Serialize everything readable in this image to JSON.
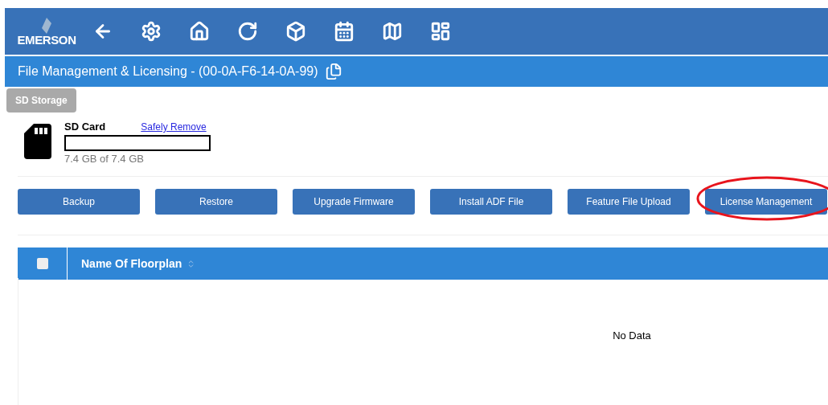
{
  "header": {
    "logo": "EMERSON",
    "toolbar": [
      {
        "kind": "back"
      },
      {
        "kind": "settings"
      },
      {
        "kind": "home"
      },
      {
        "kind": "refresh"
      },
      {
        "kind": "box"
      },
      {
        "kind": "calendar"
      },
      {
        "kind": "map"
      },
      {
        "kind": "dashboard"
      }
    ]
  },
  "title_bar": {
    "title": "File Management & Licensing - (00-0A-F6-14-0A-99)"
  },
  "storage": {
    "tooltip": "SD Storage",
    "name": "SD Card",
    "link": "Safely Remove",
    "level": 0,
    "usage": "7.4 GB of 7.4 GB"
  },
  "buttons": [
    {
      "label": "Backup",
      "highlighted": false
    },
    {
      "label": "Restore",
      "highlighted": false
    },
    {
      "label": "Upgrade Firmware",
      "highlighted": false
    },
    {
      "label": "Install ADF File",
      "highlighted": false
    },
    {
      "label": "Feature File Upload",
      "highlighted": false
    },
    {
      "label": "License Management",
      "highlighted": true
    }
  ],
  "table": {
    "select_all_checked": false,
    "columns": [
      "Name Of Floorplan"
    ],
    "empty_text": "No Data"
  }
}
